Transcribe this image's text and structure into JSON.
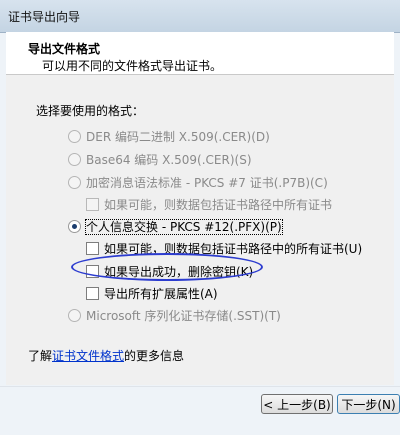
{
  "window": {
    "title": "证书导出向导"
  },
  "header": {
    "heading": "导出文件格式",
    "subheading": "可以用不同的文件格式导出证书。"
  },
  "section_label": "选择要使用的格式：",
  "options": {
    "der": "DER 编码二进制 X.509(.CER)(D)",
    "base64": "Base64 编码 X.509(.CER)(S)",
    "pkcs7": "加密消息语法标准 - PKCS #7 证书(.P7B)(C)",
    "pkcs7_include": "如果可能，则数据包括证书路径中所有证书",
    "pfx": "个人信息交换 - PKCS #12(.PFX)(P)",
    "pfx_include": "如果可能，则数据包括证书路径中的所有证书(U)",
    "pfx_delete_key": "如果导出成功，删除密钥(K)",
    "pfx_export_ext": "导出所有扩展属性(A)",
    "sst": "Microsoft 序列化证书存储(.SST)(T)"
  },
  "learn_more": {
    "prefix": "了解",
    "link": "证书文件格式",
    "suffix": "的更多信息"
  },
  "buttons": {
    "back": "< 上一步(B)",
    "next": "下一步(N)"
  },
  "colors": {
    "link": "#0033cc",
    "highlight_oval": "#2c3ccf",
    "disabled_text": "#8a8a8a"
  }
}
